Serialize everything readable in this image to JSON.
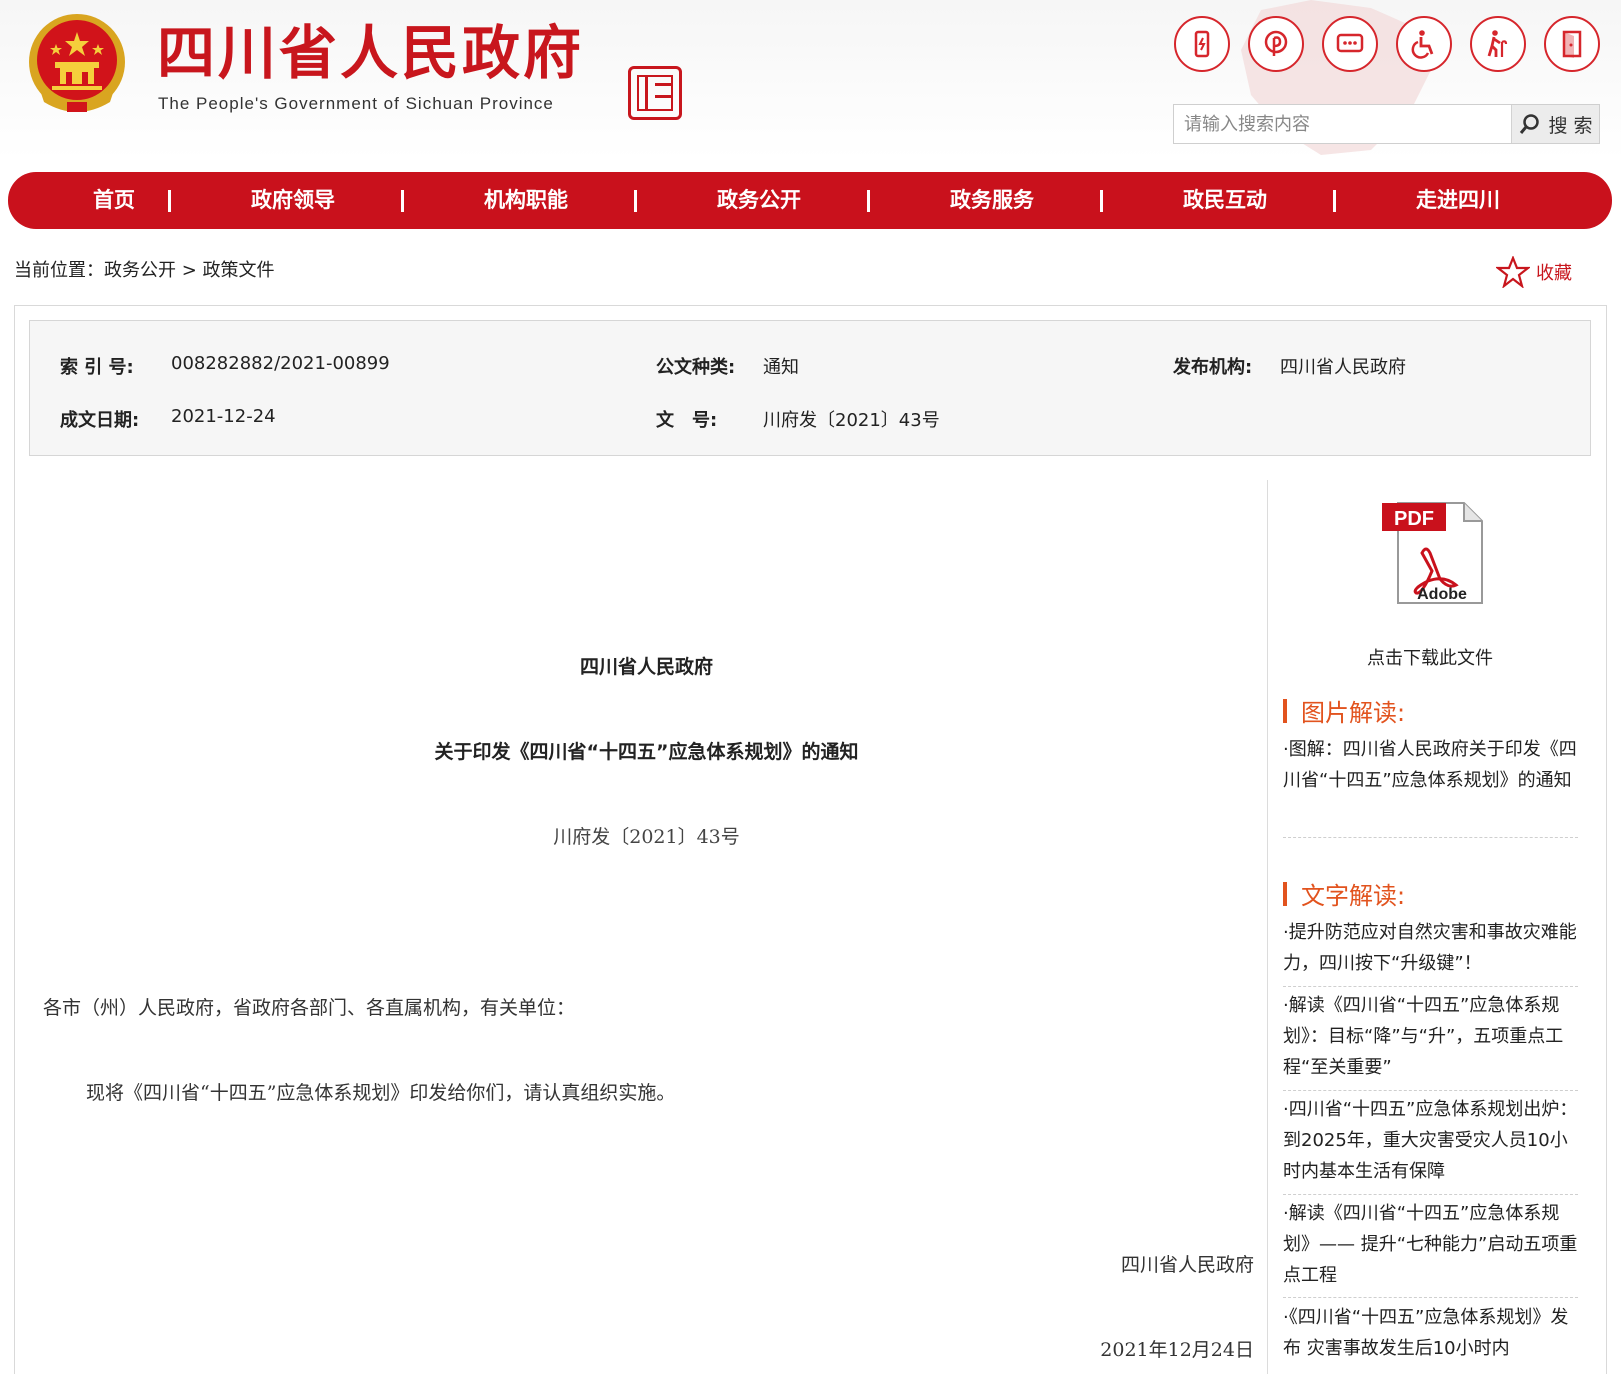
{
  "header": {
    "title": "四川省人民政府",
    "subtitle": "The People's Government of Sichuan Province",
    "icons": [
      "mobile-icon",
      "weibo-icon",
      "message-icon",
      "accessibility-icon",
      "elderly-icon",
      "exit-icon"
    ],
    "search_placeholder": "请输入搜索内容",
    "search_button": "搜 索"
  },
  "nav": {
    "items": [
      "首页",
      "政府领导",
      "机构职能",
      "政务公开",
      "政务服务",
      "政民互动",
      "走进四川"
    ]
  },
  "breadcrumb": {
    "text": "当前位置：政务公开 > 政策文件",
    "favorite_label": "收藏"
  },
  "meta": {
    "index_label": "索 引 号:",
    "index_value": "008282882/2021-00899",
    "type_label": "公文种类:",
    "type_value": "通知",
    "issuer_label": "发布机构:",
    "issuer_value": "四川省人民政府",
    "date_label": "成文日期:",
    "date_value": "2021-12-24",
    "doc_no_label": "文　号:",
    "doc_no_value": "川府发〔2021〕43号"
  },
  "article": {
    "org": "四川省人民政府",
    "title": "关于印发《四川省“十四五”应急体系规划》的通知",
    "doc_number": "川府发〔2021〕43号",
    "salutation": "各市（州）人民政府，省政府各部门、各直属机构，有关单位：",
    "body": "现将《四川省“十四五”应急体系规划》印发给你们，请认真组织实施。",
    "sign_org": "四川省人民政府",
    "sign_date": "2021年12月24日"
  },
  "sidebar": {
    "pdf_label": "点击下载此文件",
    "image_heading": "图片解读:",
    "image_items": [
      "·图解：四川省人民政府关于印发《四川省“十四五”应急体系规划》的通知"
    ],
    "text_heading": "文字解读:",
    "text_items": [
      "·提升防范应对自然灾害和事故灾难能力，四川按下“升级键”！",
      "·解读《四川省“十四五”应急体系规划》：目标“降”与“升”，五项重点工程“至关重要”",
      "·四川省“十四五”应急体系规划出炉：到2025年，重大灾害受灾人员10小时内基本生活有保障",
      "·解读《四川省“十四五”应急体系规划》—— 提升“七种能力”启动五项重点工程",
      "·《四川省“十四五”应急体系规划》发布 灾害事故发生后10小时内"
    ]
  },
  "colors": {
    "brand_red": "#c9111c",
    "accent_orange": "#e2531e"
  }
}
